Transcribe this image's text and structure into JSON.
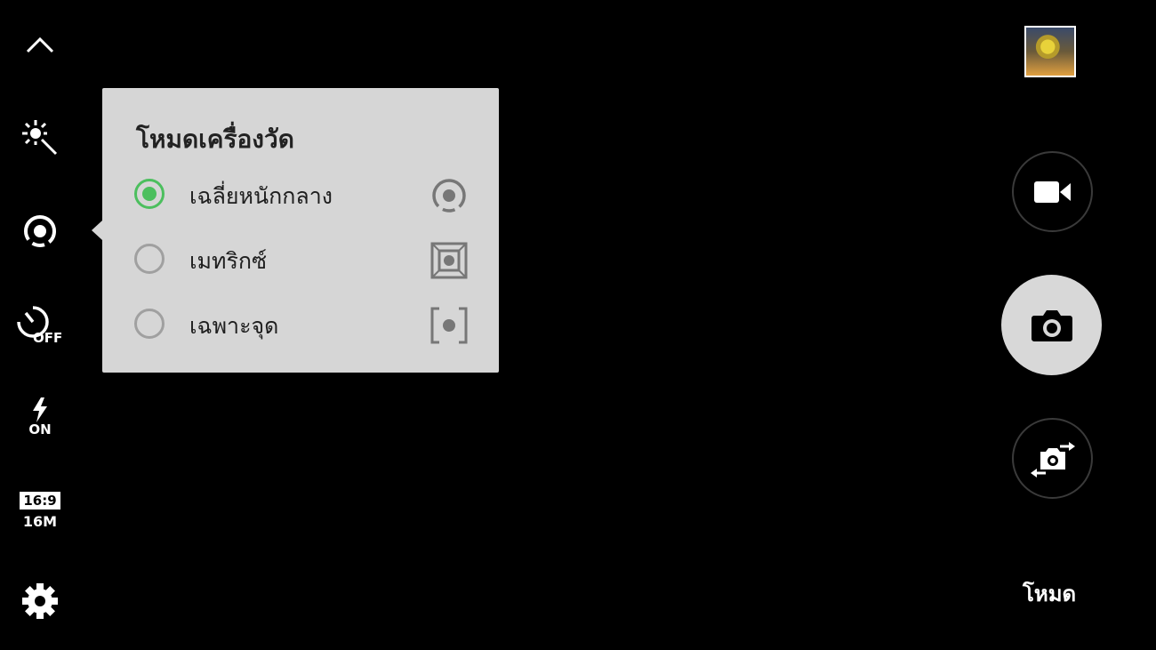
{
  "left_bar": {
    "collapse_icon": "chevron-up-icon",
    "effects_icon": "magic-wand-sun-icon",
    "metering_icon": "center-weighted-metering-icon",
    "timer": {
      "icon": "timer-icon",
      "value": "OFF"
    },
    "flash": {
      "icon": "flash-icon",
      "value": "ON"
    },
    "picture_size": {
      "ratio": "16:9",
      "resolution": "16M"
    },
    "settings_icon": "gear-icon"
  },
  "metering_popup": {
    "title": "โหมดเครื่องวัด",
    "options": [
      {
        "label": "เฉลี่ยหนักกลาง",
        "icon": "center-weighted-icon",
        "selected": true
      },
      {
        "label": "เมทริกซ์",
        "icon": "matrix-icon",
        "selected": false
      },
      {
        "label": "เฉพาะจุด",
        "icon": "spot-icon",
        "selected": false
      }
    ]
  },
  "right_bar": {
    "gallery_thumbnail": "gallery-thumbnail",
    "record_icon": "video-camera-icon",
    "capture_icon": "camera-icon",
    "switch_icon": "switch-camera-icon",
    "mode_label": "โหมด"
  },
  "colors": {
    "accent": "#4cbf5e",
    "popup_bg": "#d6d6d6",
    "background": "#000000"
  }
}
